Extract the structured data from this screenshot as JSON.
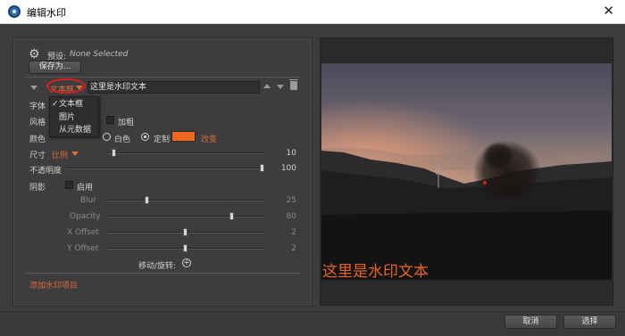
{
  "window": {
    "title": "编辑水印"
  },
  "preset": {
    "label": "预设:",
    "value": "None Selected",
    "save_as": "保存为..."
  },
  "item": {
    "type": "文本框",
    "text_value": "这里是水印文本"
  },
  "type_menu": {
    "options": [
      "文本框",
      "图片",
      "从元数据"
    ],
    "selected": "文本框"
  },
  "labels": {
    "font": "字体",
    "style": "风格",
    "bold": "加粗",
    "color": "颜色",
    "white": "白色",
    "custom": "定制",
    "change": "改变",
    "size": "尺寸",
    "size_mode": "比例",
    "opacity": "不透明度",
    "shadow": "阴影",
    "shadow_enable": "启用",
    "blur": "Blur",
    "shadow_opacity": "Opacity",
    "x_offset": "X Offset",
    "y_offset": "Y Offset",
    "move_rotate": "移动/旋转:",
    "add_item": "添加水印项目"
  },
  "values": {
    "size": "10",
    "opacity": "100",
    "blur": "25",
    "shadow_opacity": "80",
    "x_offset": "2",
    "y_offset": "2"
  },
  "levels": {
    "size": 0.03,
    "opacity": 1.0,
    "blur": 0.25,
    "shadow_opacity": 0.8,
    "x_offset": 0.5,
    "y_offset": 0.5
  },
  "colors": {
    "custom_swatch": "#f26722",
    "accent": "#e06a3c",
    "watermark": "#e8641f"
  },
  "preview": {
    "watermark_text": "这里是水印文本"
  },
  "footer": {
    "cancel": "取消",
    "ok": "选择"
  }
}
